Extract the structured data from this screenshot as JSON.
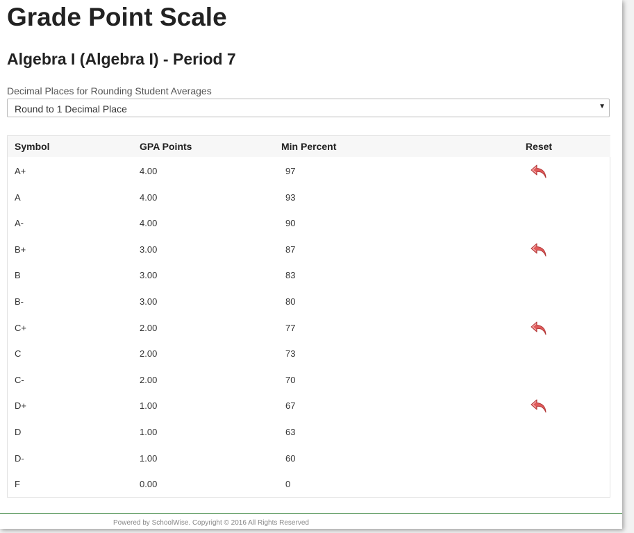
{
  "page": {
    "title": "Grade Point Scale",
    "course_title": "Algebra I (Algebra I) - Period 7"
  },
  "rounding": {
    "label": "Decimal Places for Rounding Student Averages",
    "selected": "Round to 1 Decimal Place"
  },
  "table": {
    "headers": {
      "symbol": "Symbol",
      "gpa": "GPA Points",
      "min_percent": "Min Percent",
      "reset": "Reset"
    },
    "rows": [
      {
        "symbol": "A+",
        "gpa": "4.00",
        "min": "97",
        "reset": true
      },
      {
        "symbol": "A",
        "gpa": "4.00",
        "min": "93",
        "reset": false
      },
      {
        "symbol": "A-",
        "gpa": "4.00",
        "min": "90",
        "reset": false
      },
      {
        "symbol": "B+",
        "gpa": "3.00",
        "min": "87",
        "reset": true
      },
      {
        "symbol": "B",
        "gpa": "3.00",
        "min": "83",
        "reset": false
      },
      {
        "symbol": "B-",
        "gpa": "3.00",
        "min": "80",
        "reset": false
      },
      {
        "symbol": "C+",
        "gpa": "2.00",
        "min": "77",
        "reset": true
      },
      {
        "symbol": "C",
        "gpa": "2.00",
        "min": "73",
        "reset": false
      },
      {
        "symbol": "C-",
        "gpa": "2.00",
        "min": "70",
        "reset": false
      },
      {
        "symbol": "D+",
        "gpa": "1.00",
        "min": "67",
        "reset": true
      },
      {
        "symbol": "D",
        "gpa": "1.00",
        "min": "63",
        "reset": false
      },
      {
        "symbol": "D-",
        "gpa": "1.00",
        "min": "60",
        "reset": false
      },
      {
        "symbol": "F",
        "gpa": "0.00",
        "min": "0",
        "reset": false
      }
    ],
    "reset_icon": "undo-arrow-icon"
  },
  "footer": {
    "text": "Powered by SchoolWise. Copyright © 2016 All Rights Reserved"
  },
  "colors": {
    "reset_icon": "#e05a5a",
    "footer_line": "#2e7d32"
  }
}
